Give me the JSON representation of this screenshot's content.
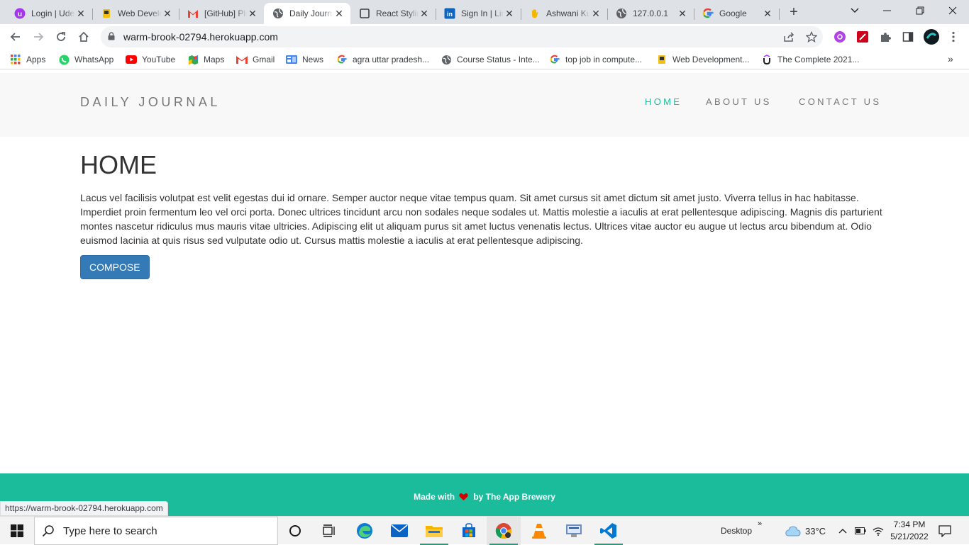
{
  "browser": {
    "tabs": [
      {
        "title": "Login | Udemy",
        "icon": "udemy-icon",
        "active": false
      },
      {
        "title": "Web Development",
        "icon": "bookmark-icon",
        "active": false
      },
      {
        "title": "[GitHub] Please verify",
        "icon": "gmail-icon",
        "active": false
      },
      {
        "title": "Daily Journal",
        "icon": "globe-icon",
        "active": true
      },
      {
        "title": "React Styling",
        "icon": "page-icon",
        "active": false
      },
      {
        "title": "Sign In | LinkedIn",
        "icon": "linkedin-icon",
        "active": false
      },
      {
        "title": "Ashwani Kumar",
        "icon": "hand-icon",
        "active": false
      },
      {
        "title": "127.0.0.1",
        "icon": "globe-icon",
        "active": false
      },
      {
        "title": "Google",
        "icon": "google-icon",
        "active": false
      }
    ],
    "url": "warm-brook-02794.herokuapp.com",
    "bookmarks": [
      {
        "label": "Apps",
        "icon": "apps-grid-icon"
      },
      {
        "label": "WhatsApp",
        "icon": "whatsapp-icon"
      },
      {
        "label": "YouTube",
        "icon": "youtube-icon"
      },
      {
        "label": "Maps",
        "icon": "maps-icon"
      },
      {
        "label": "Gmail",
        "icon": "gmail-icon"
      },
      {
        "label": "News",
        "icon": "news-icon"
      },
      {
        "label": "agra uttar pradesh...",
        "icon": "google-icon"
      },
      {
        "label": "Course Status - Inte...",
        "icon": "globe-icon"
      },
      {
        "label": "top job in compute...",
        "icon": "google-icon"
      },
      {
        "label": "Web Development...",
        "icon": "bookmark-icon"
      },
      {
        "label": "The Complete 2021...",
        "icon": "udemy-icon"
      }
    ],
    "status_url": "https://warm-brook-02794.herokuapp.com"
  },
  "site": {
    "brand": "DAILY JOURNAL",
    "nav": [
      {
        "label": "HOME",
        "active": true
      },
      {
        "label": "ABOUT US",
        "active": false
      },
      {
        "label": "CONTACT US",
        "active": false
      }
    ],
    "heading": "HOME",
    "paragraph": "Lacus vel facilisis volutpat est velit egestas dui id ornare. Semper auctor neque vitae tempus quam. Sit amet cursus sit amet dictum sit amet justo. Viverra tellus in hac habitasse. Imperdiet proin fermentum leo vel orci porta. Donec ultrices tincidunt arcu non sodales neque sodales ut. Mattis molestie a iaculis at erat pellentesque adipiscing. Magnis dis parturient montes nascetur ridiculus mus mauris vitae ultricies. Adipiscing elit ut aliquam purus sit amet luctus venenatis lectus. Ultrices vitae auctor eu augue ut lectus arcu bibendum at. Odio euismod lacinia at quis risus sed vulputate odio ut. Cursus mattis molestie a iaculis at erat pellentesque adipiscing.",
    "compose_label": "COMPOSE",
    "footer": {
      "made_with": "Made with",
      "by": "by The App Brewery"
    }
  },
  "taskbar": {
    "search_placeholder": "Type here to search",
    "desktop_label": "Desktop",
    "temperature": "33°C",
    "time": "7:34 PM",
    "date": "5/21/2022"
  },
  "colors": {
    "accent": "#1abc9c",
    "button": "#337ab7"
  }
}
